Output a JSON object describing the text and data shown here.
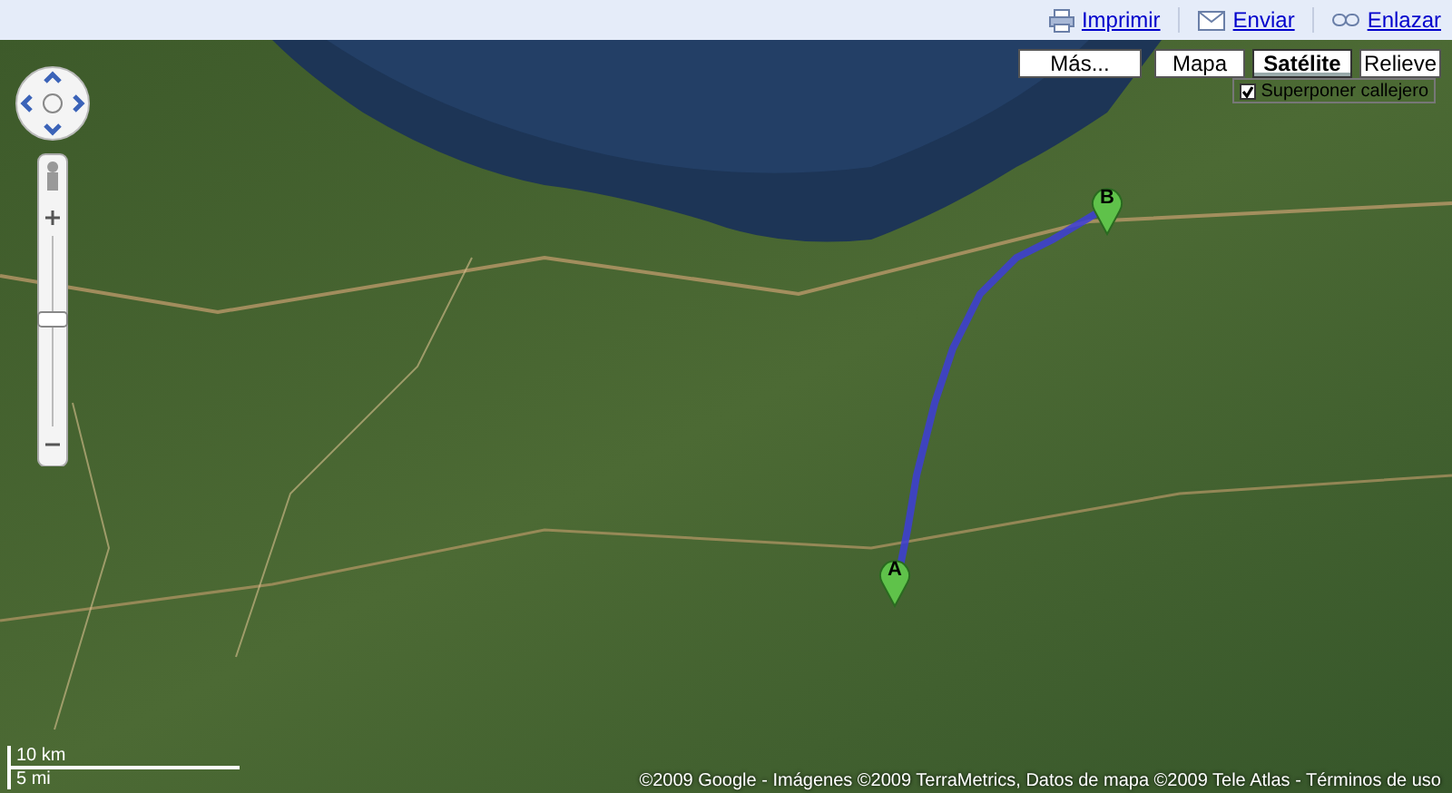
{
  "toolbar": {
    "links": [
      {
        "kind": "print",
        "label": "Imprimir"
      },
      {
        "kind": "mail",
        "label": "Enviar"
      },
      {
        "kind": "link",
        "label": "Enlazar"
      }
    ]
  },
  "map": {
    "map_types": [
      {
        "label": "Más...",
        "selected": false
      },
      {
        "label": "Mapa",
        "selected": false
      },
      {
        "label": "Satélite",
        "selected": true
      },
      {
        "label": "Relieve",
        "selected": false
      }
    ],
    "overlay": {
      "label": "Superponer callejero",
      "checked": true
    },
    "markers": [
      {
        "label": "A"
      },
      {
        "label": "B"
      }
    ],
    "scale": [
      "10 km",
      "5 mi"
    ],
    "copyright": "©2009 Google - Imágenes ©2009 TerraMetrics, Datos de mapa ©2009 Tele Atlas - Términos de uso"
  }
}
